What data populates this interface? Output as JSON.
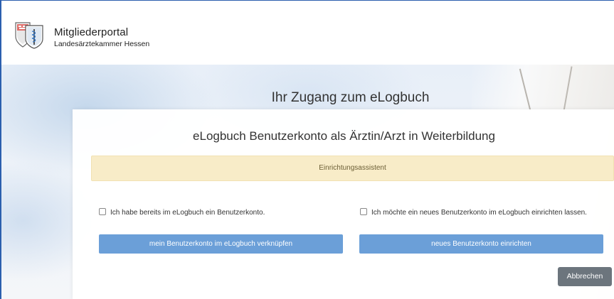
{
  "header": {
    "title": "Mitgliederportal",
    "subtitle": "Landesärztekammer Hessen",
    "logo_icon": "landesaerztekammer-hessen-logo"
  },
  "hero": {
    "title": "Ihr Zugang zum eLogbuch"
  },
  "card": {
    "title": "eLogbuch Benutzerkonto als Ärztin/Arzt in Weiterbildung",
    "alert": "Einrichtungsassistent",
    "option_existing_label": "Ich habe bereits im eLogbuch ein Benutzerkonto.",
    "option_new_label": "Ich möchte ein neues Benutzerkonto im eLogbuch einrichten lassen.",
    "link_button_label": "mein Benutzerkonto im eLogbuch verknüpfen",
    "create_button_label": "neues Benutzerkonto einrichten",
    "cancel_button_label": "Abbrechen"
  },
  "colors": {
    "primary_button": "#6b9fd8",
    "cancel_button": "#6c757d",
    "alert_background": "#f8ecc8",
    "frame_border": "#2b5fae"
  }
}
